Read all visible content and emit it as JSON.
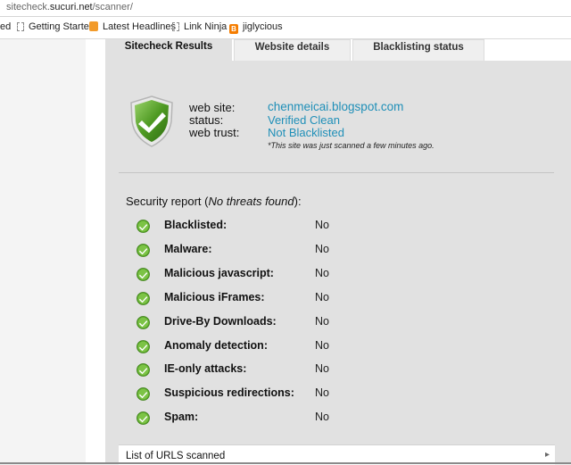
{
  "browser": {
    "url_prefix": "sitecheck.",
    "url_domain": "sucuri.net",
    "url_path": "/scanner/",
    "bookmarks": [
      {
        "label": "ed",
        "icon": "page-icon"
      },
      {
        "label": "Getting Started",
        "icon": "page-icon"
      },
      {
        "label": "Latest Headlines",
        "icon": "rss-icon"
      },
      {
        "label": "Link Ninja",
        "icon": "page-icon"
      },
      {
        "label": "jiglycious",
        "icon": "blogger-icon"
      }
    ]
  },
  "tabs": [
    {
      "label": "Sitecheck Results",
      "active": true
    },
    {
      "label": "Website details",
      "active": false
    },
    {
      "label": "Blacklisting status",
      "active": false
    }
  ],
  "summary": {
    "website_label": "web site:",
    "website_value": "chenmeicai.blogspot.com",
    "status_label": "status:",
    "status_value": "Verified Clean",
    "trust_label": "web trust:",
    "trust_value": "Not Blacklisted",
    "note": "*This site was just scanned a few minutes ago."
  },
  "report": {
    "title_prefix": "Security report (",
    "title_emph": "No threats found",
    "title_suffix": "):",
    "rows": [
      {
        "label": "Blacklisted:",
        "value": "No"
      },
      {
        "label": "Malware:",
        "value": "No"
      },
      {
        "label": "Malicious javascript:",
        "value": "No"
      },
      {
        "label": "Malicious iFrames:",
        "value": "No"
      },
      {
        "label": "Drive-By Downloads:",
        "value": "No"
      },
      {
        "label": "Anomaly detection:",
        "value": "No"
      },
      {
        "label": "IE-only attacks:",
        "value": "No"
      },
      {
        "label": "Suspicious redirections:",
        "value": "No"
      },
      {
        "label": "Spam:",
        "value": "No"
      }
    ]
  },
  "urls_section": {
    "label": "List of URLS scanned",
    "arrow": "▸"
  },
  "colors": {
    "link": "#1f8fb8",
    "check_green": "#5aa82a",
    "panel": "#e1e1e1"
  }
}
